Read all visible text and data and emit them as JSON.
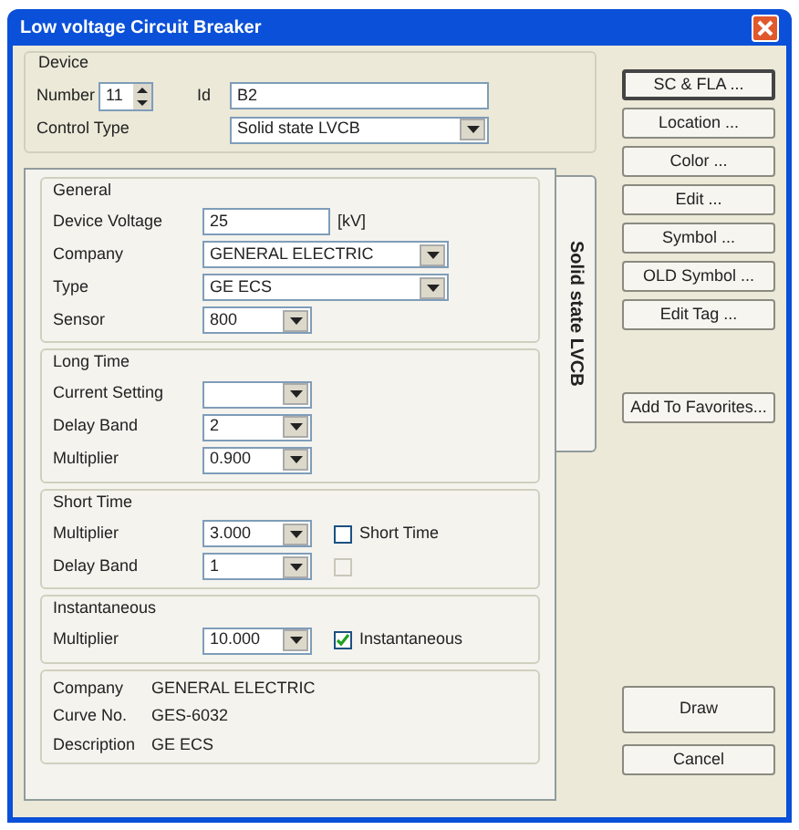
{
  "window": {
    "title": "Low voltage Circuit Breaker"
  },
  "device": {
    "title": "Device",
    "number": {
      "label": "Number",
      "value": "11"
    },
    "id": {
      "label": "Id",
      "value": "B2"
    },
    "control_type": {
      "label": "Control Type",
      "value": "Solid state LVCB"
    }
  },
  "side_buttons": [
    {
      "label": "SC & FLA ...",
      "default": true
    },
    {
      "label": "Location ...",
      "default": false
    },
    {
      "label": "Color ...",
      "default": false
    },
    {
      "label": "Edit ...",
      "default": false
    },
    {
      "label": "Symbol ...",
      "default": false
    },
    {
      "label": "OLD Symbol ...",
      "default": false
    },
    {
      "label": "Edit Tag ...",
      "default": false
    }
  ],
  "favorites_button": {
    "label": "Add To Favorites..."
  },
  "tab": {
    "label": "Solid state LVCB"
  },
  "sections": [
    {
      "title": "General",
      "rows": [
        {
          "kind": "text",
          "label": "Device Voltage",
          "value": "25",
          "unit": "[kV]"
        },
        {
          "kind": "wide_dropdown",
          "label": "Company",
          "value": "GENERAL ELECTRIC"
        },
        {
          "kind": "wide_dropdown",
          "label": "Type",
          "value": "GE ECS"
        },
        {
          "kind": "dropdown",
          "label": "Sensor",
          "value": "800"
        }
      ]
    },
    {
      "title": "Long Time",
      "rows": [
        {
          "kind": "dropdown",
          "label": "Current Setting",
          "value": ""
        },
        {
          "kind": "dropdown",
          "label": "Delay Band",
          "value": "2"
        },
        {
          "kind": "dropdown",
          "label": "Multiplier",
          "value": "0.900"
        }
      ]
    },
    {
      "title": "Short Time",
      "rows": [
        {
          "kind": "dropdown",
          "label": "Multiplier",
          "value": "3.000",
          "checkbox": {
            "label": "Short Time",
            "checked": false,
            "disabled": false
          }
        },
        {
          "kind": "dropdown",
          "label": "Delay Band",
          "value": "1",
          "checkbox": {
            "checked": false,
            "disabled": true
          }
        }
      ]
    },
    {
      "title": "Instantaneous",
      "rows": [
        {
          "kind": "dropdown",
          "label": "Multiplier",
          "value": "10.000",
          "checkbox": {
            "label": "Instantaneous",
            "checked": true,
            "disabled": false
          }
        }
      ]
    }
  ],
  "info": [
    {
      "label": "Company",
      "value": "GENERAL ELECTRIC"
    },
    {
      "label": "Curve No.",
      "value": "GES-6032"
    },
    {
      "label": "Description",
      "value": "GE ECS"
    }
  ],
  "dialog_buttons": [
    {
      "label": "Draw"
    },
    {
      "label": "Cancel"
    }
  ]
}
